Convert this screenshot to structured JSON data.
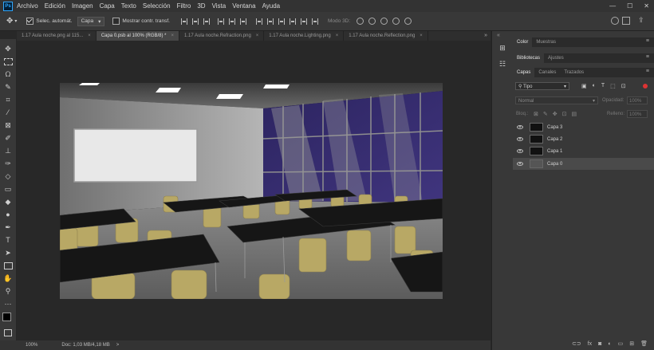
{
  "menubar": {
    "logo": "Ps",
    "items": [
      "Archivo",
      "Edición",
      "Imagen",
      "Capa",
      "Texto",
      "Selección",
      "Filtro",
      "3D",
      "Vista",
      "Ventana",
      "Ayuda"
    ],
    "controls": [
      "—",
      "☐",
      "✕"
    ]
  },
  "options": {
    "auto_select_label": "Selec. automát.",
    "auto_select_target": "Capa",
    "show_transform_label": "Mostrar contr. transf.",
    "mode_3d_label": "Modo 3D:"
  },
  "tabs": [
    {
      "label": "1.17 Aula noche.png al 115...",
      "close": "×",
      "active": false
    },
    {
      "label": "Capa 0.psb al 100% (RGB/8) *",
      "close": "×",
      "active": true
    },
    {
      "label": "1.17 Aula noche.Refraction.png",
      "close": "×",
      "active": false
    },
    {
      "label": "1.17 Aula noche.Lighting.png",
      "close": "×",
      "active": false
    },
    {
      "label": "1.17 Aula noche.Reflection.png",
      "close": "×",
      "active": false
    }
  ],
  "tabs_overflow": "»",
  "status": {
    "zoom": "100%",
    "doc": "Doc: 1,03 MB/4,18 MB",
    "arrow": ">"
  },
  "panels": {
    "top_tabs": [
      "Color",
      "Muestras"
    ],
    "mid_tabs": [
      "Bibliotecas",
      "Ajustes"
    ],
    "layer_tabs": [
      "Capas",
      "Canales",
      "Trazados"
    ],
    "filter_kind": "Tipo",
    "blend_mode": "Normal",
    "opacity_label": "Opacidad:",
    "opacity_value": "100%",
    "lock_label": "Bloq.:",
    "fill_label": "Relleno:",
    "fill_value": "100%",
    "menu_icon": "≡",
    "layers": [
      {
        "name": "Capa 3",
        "selected": false
      },
      {
        "name": "Capa 2",
        "selected": false
      },
      {
        "name": "Capa 1",
        "selected": false
      },
      {
        "name": "Capa 0",
        "selected": true
      }
    ],
    "footer_icons": [
      "link-icon",
      "fx-icon",
      "mask-icon",
      "adjustment-icon",
      "group-icon",
      "new-layer-icon",
      "trash-icon"
    ]
  },
  "colors": {
    "workspace": "#282828",
    "panel": "#383838",
    "accent": "#31a8ff",
    "chair_yellow": "#b8a865",
    "window_purple": "#3a2f6e"
  }
}
